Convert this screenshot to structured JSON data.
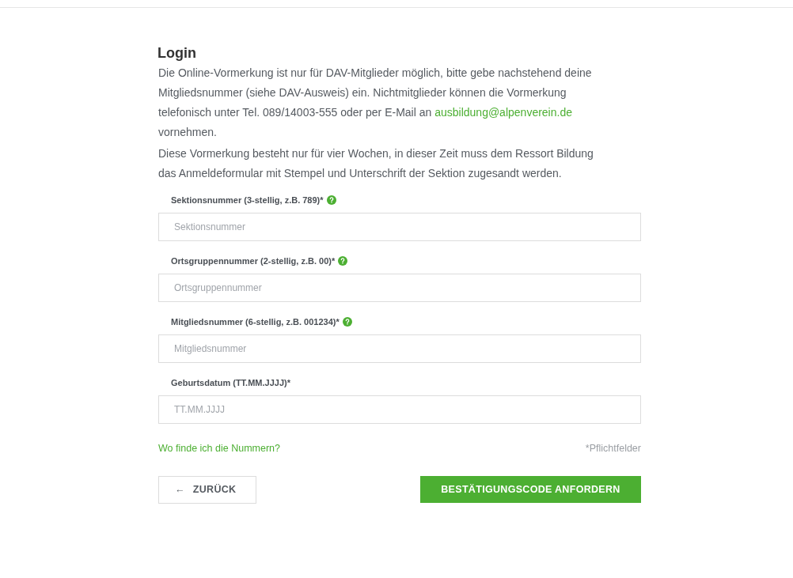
{
  "title": "Login",
  "intro": {
    "before": "Die Online-Vormerkung ist nur für DAV-Mitglieder möglich, bitte gebe nachstehend deine Mitgliedsnummer (siehe DAV-Ausweis) ein. Nichtmitglieder können die Vormerkung telefonisch unter Tel. 089/14003-555 oder per E-Mail an",
    "link": "ausbildung@alpenverein.de",
    "after": "vornehmen."
  },
  "note": "Diese Vormerkung besteht nur für vier Wochen, in dieser Zeit muss dem Ressort Bildung das Anmeldeformular mit Stempel und Unterschrift der Sektion zugesandt werden.",
  "fields": [
    {
      "label": "Sektionsnummer (3-stellig, z.B. 789)*",
      "help": true,
      "placeholder": "Sektionsnummer"
    },
    {
      "label": "Ortsgruppennummer (2-stellig, z.B. 00)*",
      "help": true,
      "placeholder": "Ortsgruppennummer"
    },
    {
      "label": "Mitgliedsnummer (6-stellig, z.B. 001234)*",
      "help": true,
      "placeholder": "Mitgliedsnummer"
    },
    {
      "label": "Geburtsdatum (TT.MM.JJJJ)*",
      "help": false,
      "placeholder": "TT.MM.JJJJ"
    }
  ],
  "help_link": "Wo finde ich die Nummern?",
  "required_note": "*Pflichtfelder",
  "back_button": {
    "arrow": "←",
    "label": "ZURÜCK"
  },
  "submit_button": "BESTÄTIGUNGSCODE ANFORDERN"
}
